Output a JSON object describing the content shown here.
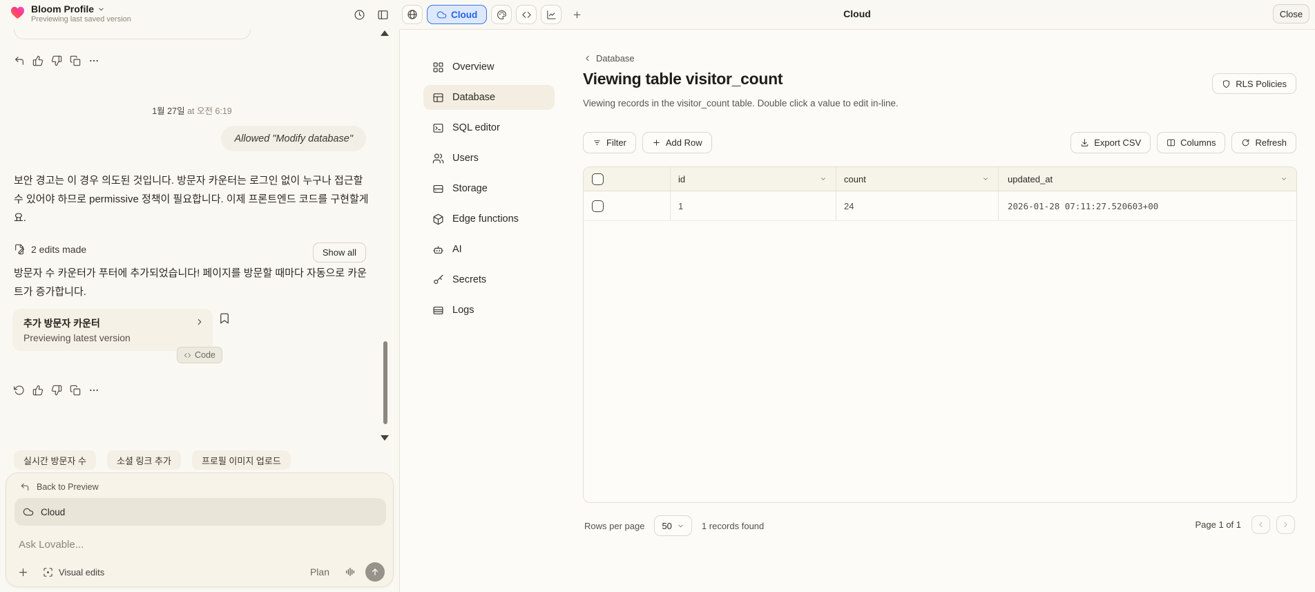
{
  "topbar": {
    "brand_name": "Bloom Profile",
    "brand_status": "Previewing last saved version",
    "cloud_tab_label": "Cloud",
    "panel_title": "Cloud",
    "close_label": "Close"
  },
  "chat": {
    "timestamp_date": "1월 27일",
    "timestamp_time": "at 오전 6:19",
    "user_bubble": "Allowed \"Modify database\"",
    "assistant_message_1": "보안 경고는 이 경우 의도된 것입니다. 방문자 카운터는 로그인 없이 누구나 접근할 수 있어야 하므로 permissive 정책이 필요합니다. 이제 프론트엔드 코드를 구현할게요.",
    "edits_summary": "2 edits made",
    "show_all_label": "Show all",
    "assistant_message_2": "방문자 수 카운터가 푸터에 추가되었습니다! 페이지를 방문할 때마다 자동으로 카운트가 증가합니다.",
    "version_card": {
      "title": "추가 방문자 카운터",
      "subtitle": "Previewing latest version",
      "code_label": "Code"
    },
    "suggestions": [
      "실시간 방문자 수",
      "소셜 링크 추가",
      "프로필 이미지 업로드"
    ],
    "composer": {
      "back_label": "Back to Preview",
      "context_label": "Cloud",
      "placeholder": "Ask Lovable...",
      "visual_edits_label": "Visual edits",
      "plan_label": "Plan"
    }
  },
  "cloud": {
    "sidebar": [
      {
        "label": "Overview"
      },
      {
        "label": "Database"
      },
      {
        "label": "SQL editor"
      },
      {
        "label": "Users"
      },
      {
        "label": "Storage"
      },
      {
        "label": "Edge functions"
      },
      {
        "label": "AI"
      },
      {
        "label": "Secrets"
      },
      {
        "label": "Logs"
      }
    ],
    "breadcrumb": "Database",
    "title": "Viewing table visitor_count",
    "description": "Viewing records in the visitor_count table. Double click a value to edit in-line.",
    "rls_label": "RLS Policies",
    "toolbar": {
      "filter": "Filter",
      "add_row": "Add Row",
      "export_csv": "Export CSV",
      "columns": "Columns",
      "refresh": "Refresh"
    },
    "table": {
      "headers": [
        "id",
        "count",
        "updated_at"
      ],
      "rows": [
        {
          "id": "1",
          "count": "24",
          "updated_at": "2026-01-28 07:11:27.520603+00"
        }
      ]
    },
    "footer": {
      "rows_per_page_label": "Rows per page",
      "page_size": "50",
      "records_label": "1 records found",
      "page_label": "Page 1 of 1"
    }
  },
  "colors": {
    "accent_blue": "#2563eb",
    "cloud_tab_bg": "#dce8fb",
    "cloud_tab_border": "#3c76e1",
    "page_bg": "#faf8f3",
    "panel_bg": "#fcfbf7",
    "send_button": "#97928a"
  }
}
